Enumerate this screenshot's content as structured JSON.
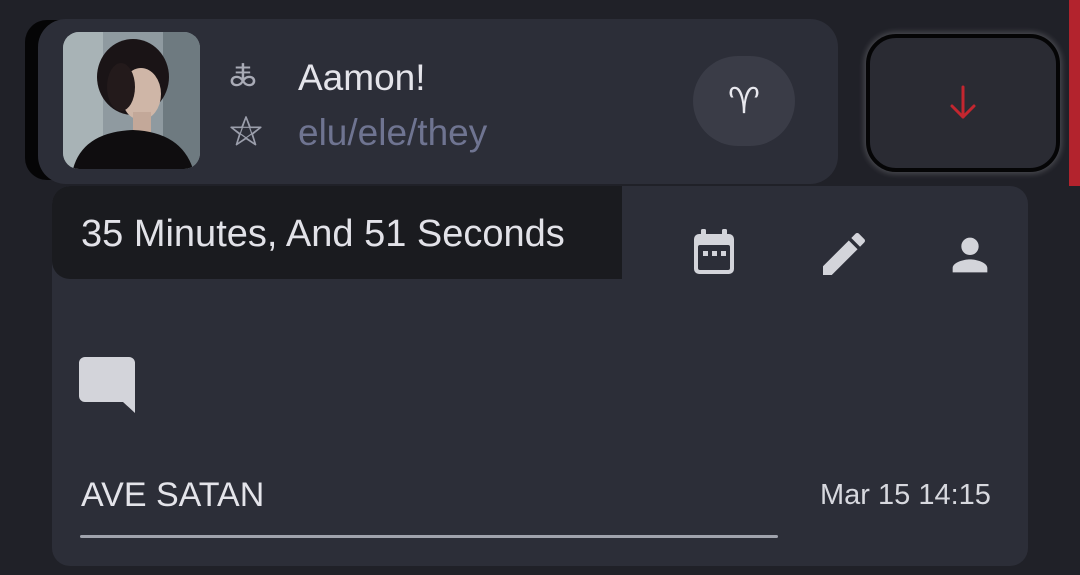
{
  "profile": {
    "name": "Aamon!",
    "pronouns": "elu/ele/they",
    "name_symbol": "🜏",
    "pronoun_symbol_icon": "pentagram-icon",
    "sign_symbol": "♈︎"
  },
  "timer": {
    "duration": "35 Minutes, And 51 Seconds"
  },
  "message": {
    "text": "AVE SATAN",
    "timestamp": "Mar 15 14:15"
  },
  "colors": {
    "accent_red": "#b3232d",
    "card": "#2c2e38",
    "background": "#202128",
    "pronoun_text": "#6f7491"
  }
}
